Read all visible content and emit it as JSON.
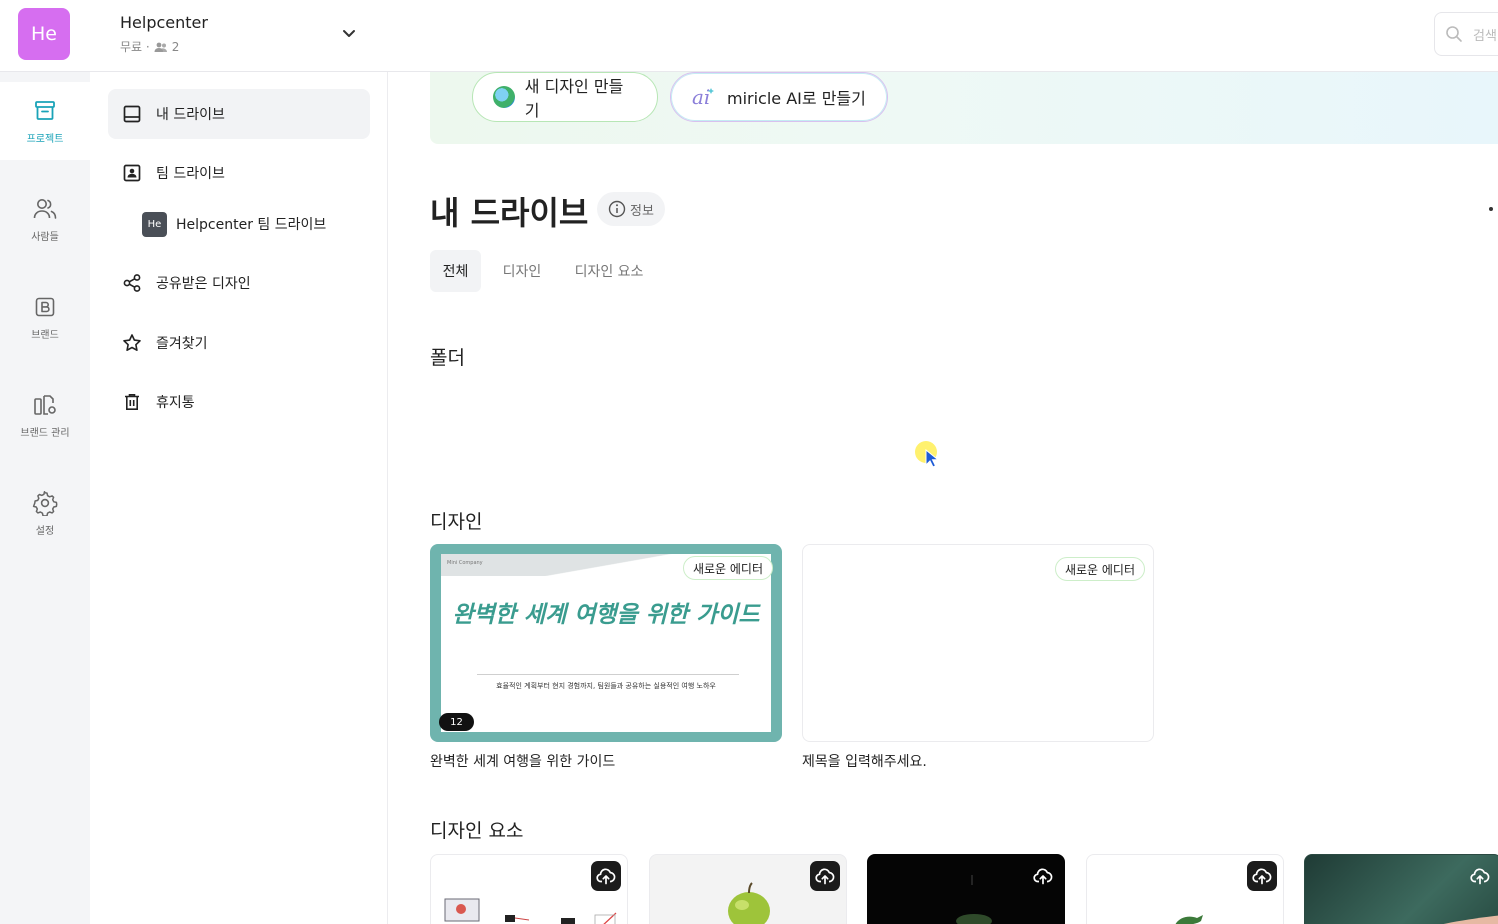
{
  "header": {
    "workspace_initials": "He",
    "workspace_name": "Helpcenter",
    "plan": "무료 ·",
    "member_count": "2",
    "search_placeholder": "검색"
  },
  "rail": {
    "items": [
      {
        "label": "프로젝트",
        "active": true
      },
      {
        "label": "사람들"
      },
      {
        "label": "브랜드"
      },
      {
        "label": "브랜드 관리"
      },
      {
        "label": "설정"
      }
    ]
  },
  "sidebar": {
    "my_drive": "내 드라이브",
    "team_drive": "팀 드라이브",
    "team_sub_initials": "He",
    "team_sub_label": "Helpcenter 팀 드라이브",
    "shared": "공유받은 디자인",
    "favorites": "즐겨찾기",
    "trash": "휴지통"
  },
  "banner": {
    "new_design": "새 디자인 만들기",
    "ai_create": "miricle AI로 만들기"
  },
  "main": {
    "title": "내 드라이브",
    "info": "정보",
    "tabs": [
      "전체",
      "디자인",
      "디자인 요소"
    ],
    "folder_heading": "폴더",
    "design_heading": "디자인",
    "elements_heading": "디자인 요소"
  },
  "designs": [
    {
      "badge": "새로운 에디터",
      "slide_company": "Mini Company",
      "slide_title": "완벽한 세계 여행을 위한 가이드",
      "slide_subtitle": "효율적인 계획부터 현지 경험까지, 팀원들과 공유하는 실용적인 여행 노하우",
      "page_count": "12",
      "caption": "완벽한 세계 여행을 위한 가이드"
    },
    {
      "badge": "새로운 에디터",
      "caption": "제목을 입력해주세요."
    }
  ],
  "colors": {
    "accent": "#1aa3b8",
    "workspace_avatar": "#d66ef0",
    "slide_title": "#3a9c8f"
  }
}
